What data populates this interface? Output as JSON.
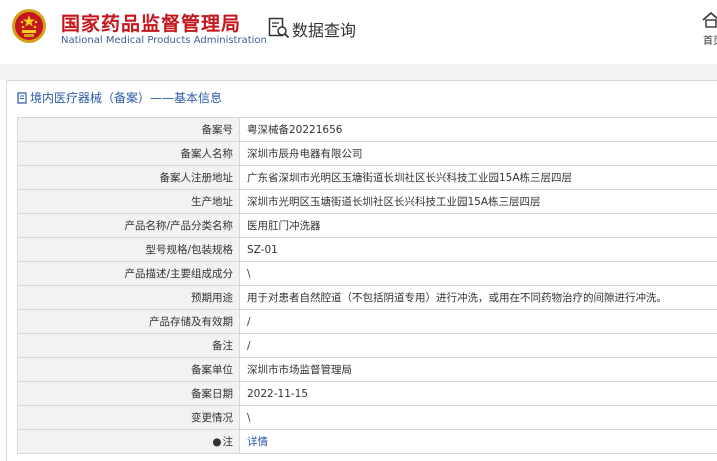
{
  "header": {
    "org_name_cn": "国家药品监督管理局",
    "org_name_en": "National Medical Products Administration",
    "section_title": "数据查询",
    "home_label": "首页"
  },
  "breadcrumb": "境内医疗器械（备案）——基本信息",
  "rows": [
    {
      "label": "备案号",
      "value": "粤深械备20221656"
    },
    {
      "label": "备案人名称",
      "value": "深圳市辰舟电器有限公司"
    },
    {
      "label": "备案人注册地址",
      "value": "广东省深圳市光明区玉塘街道长圳社区长兴科技工业园15A栋三层四层"
    },
    {
      "label": "生产地址",
      "value": "深圳市光明区玉塘街道长圳社区长兴科技工业园15A栋三层四层"
    },
    {
      "label": "产品名称/产品分类名称",
      "value": "医用肛门冲洗器"
    },
    {
      "label": "型号规格/包装规格",
      "value": "SZ-01"
    },
    {
      "label": "产品描述/主要组成成分",
      "value": "\\"
    },
    {
      "label": "预期用途",
      "value": "用于对患者自然腔道（不包括阴道专用）进行冲洗，或用在不同药物治疗的间隙进行冲洗。"
    },
    {
      "label": "产品存储及有效期",
      "value": "/"
    },
    {
      "label": "备注",
      "value": "/"
    },
    {
      "label": "备案单位",
      "value": "深圳市市场监督管理局"
    },
    {
      "label": "备案日期",
      "value": "2022-11-15"
    },
    {
      "label": "变更情况",
      "value": "\\"
    }
  ],
  "note_row": {
    "star": "●",
    "label": "注",
    "link": "详情"
  },
  "colors": {
    "brand_red": "#c4161c",
    "link_blue": "#2d5aa8",
    "label_bg": "#f2f2f2"
  }
}
